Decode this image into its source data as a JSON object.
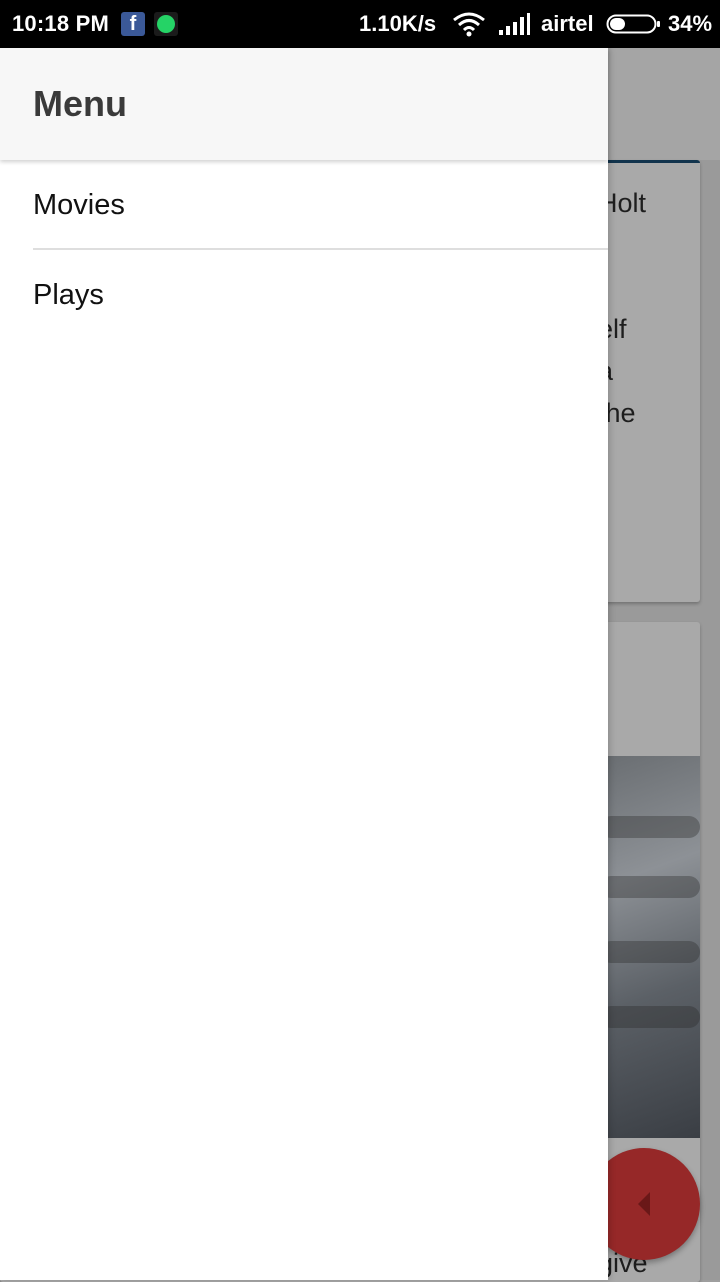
{
  "status_bar": {
    "time": "10:18 PM",
    "network_speed": "1.10K/s",
    "carrier": "airtel",
    "battery_percent": "34%",
    "battery_level": 0.34,
    "notification_icons": [
      "facebook-icon",
      "whatsapp-icon"
    ],
    "fb_glyph": "f"
  },
  "drawer": {
    "title": "Menu",
    "items": [
      {
        "label": "Movies"
      },
      {
        "label": "Plays"
      }
    ]
  },
  "background": {
    "text_fragments": [
      "Holt",
      "elf",
      "a",
      "the",
      "give"
    ],
    "fab_icon": "chevron-left-icon",
    "accent_color": "#962828"
  },
  "colors": {
    "status_bar": "#000000",
    "drawer_background": "#ffffff",
    "drawer_header": "#f7f7f7",
    "fab": "#c62828"
  }
}
